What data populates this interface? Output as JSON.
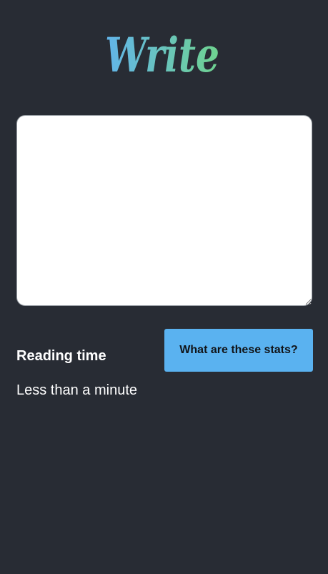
{
  "app": {
    "logo_text": "Write"
  },
  "editor": {
    "value": "",
    "placeholder": ""
  },
  "stats": {
    "reading_time_label": "Reading time",
    "reading_time_value": "Less than a minute",
    "help_button_label": "What are these stats?",
    "help_button_color": "#5ab2f0"
  },
  "colors": {
    "background": "#282c34",
    "logo_gradient_start": "#62b4ea",
    "logo_gradient_end": "#6fd38f"
  }
}
